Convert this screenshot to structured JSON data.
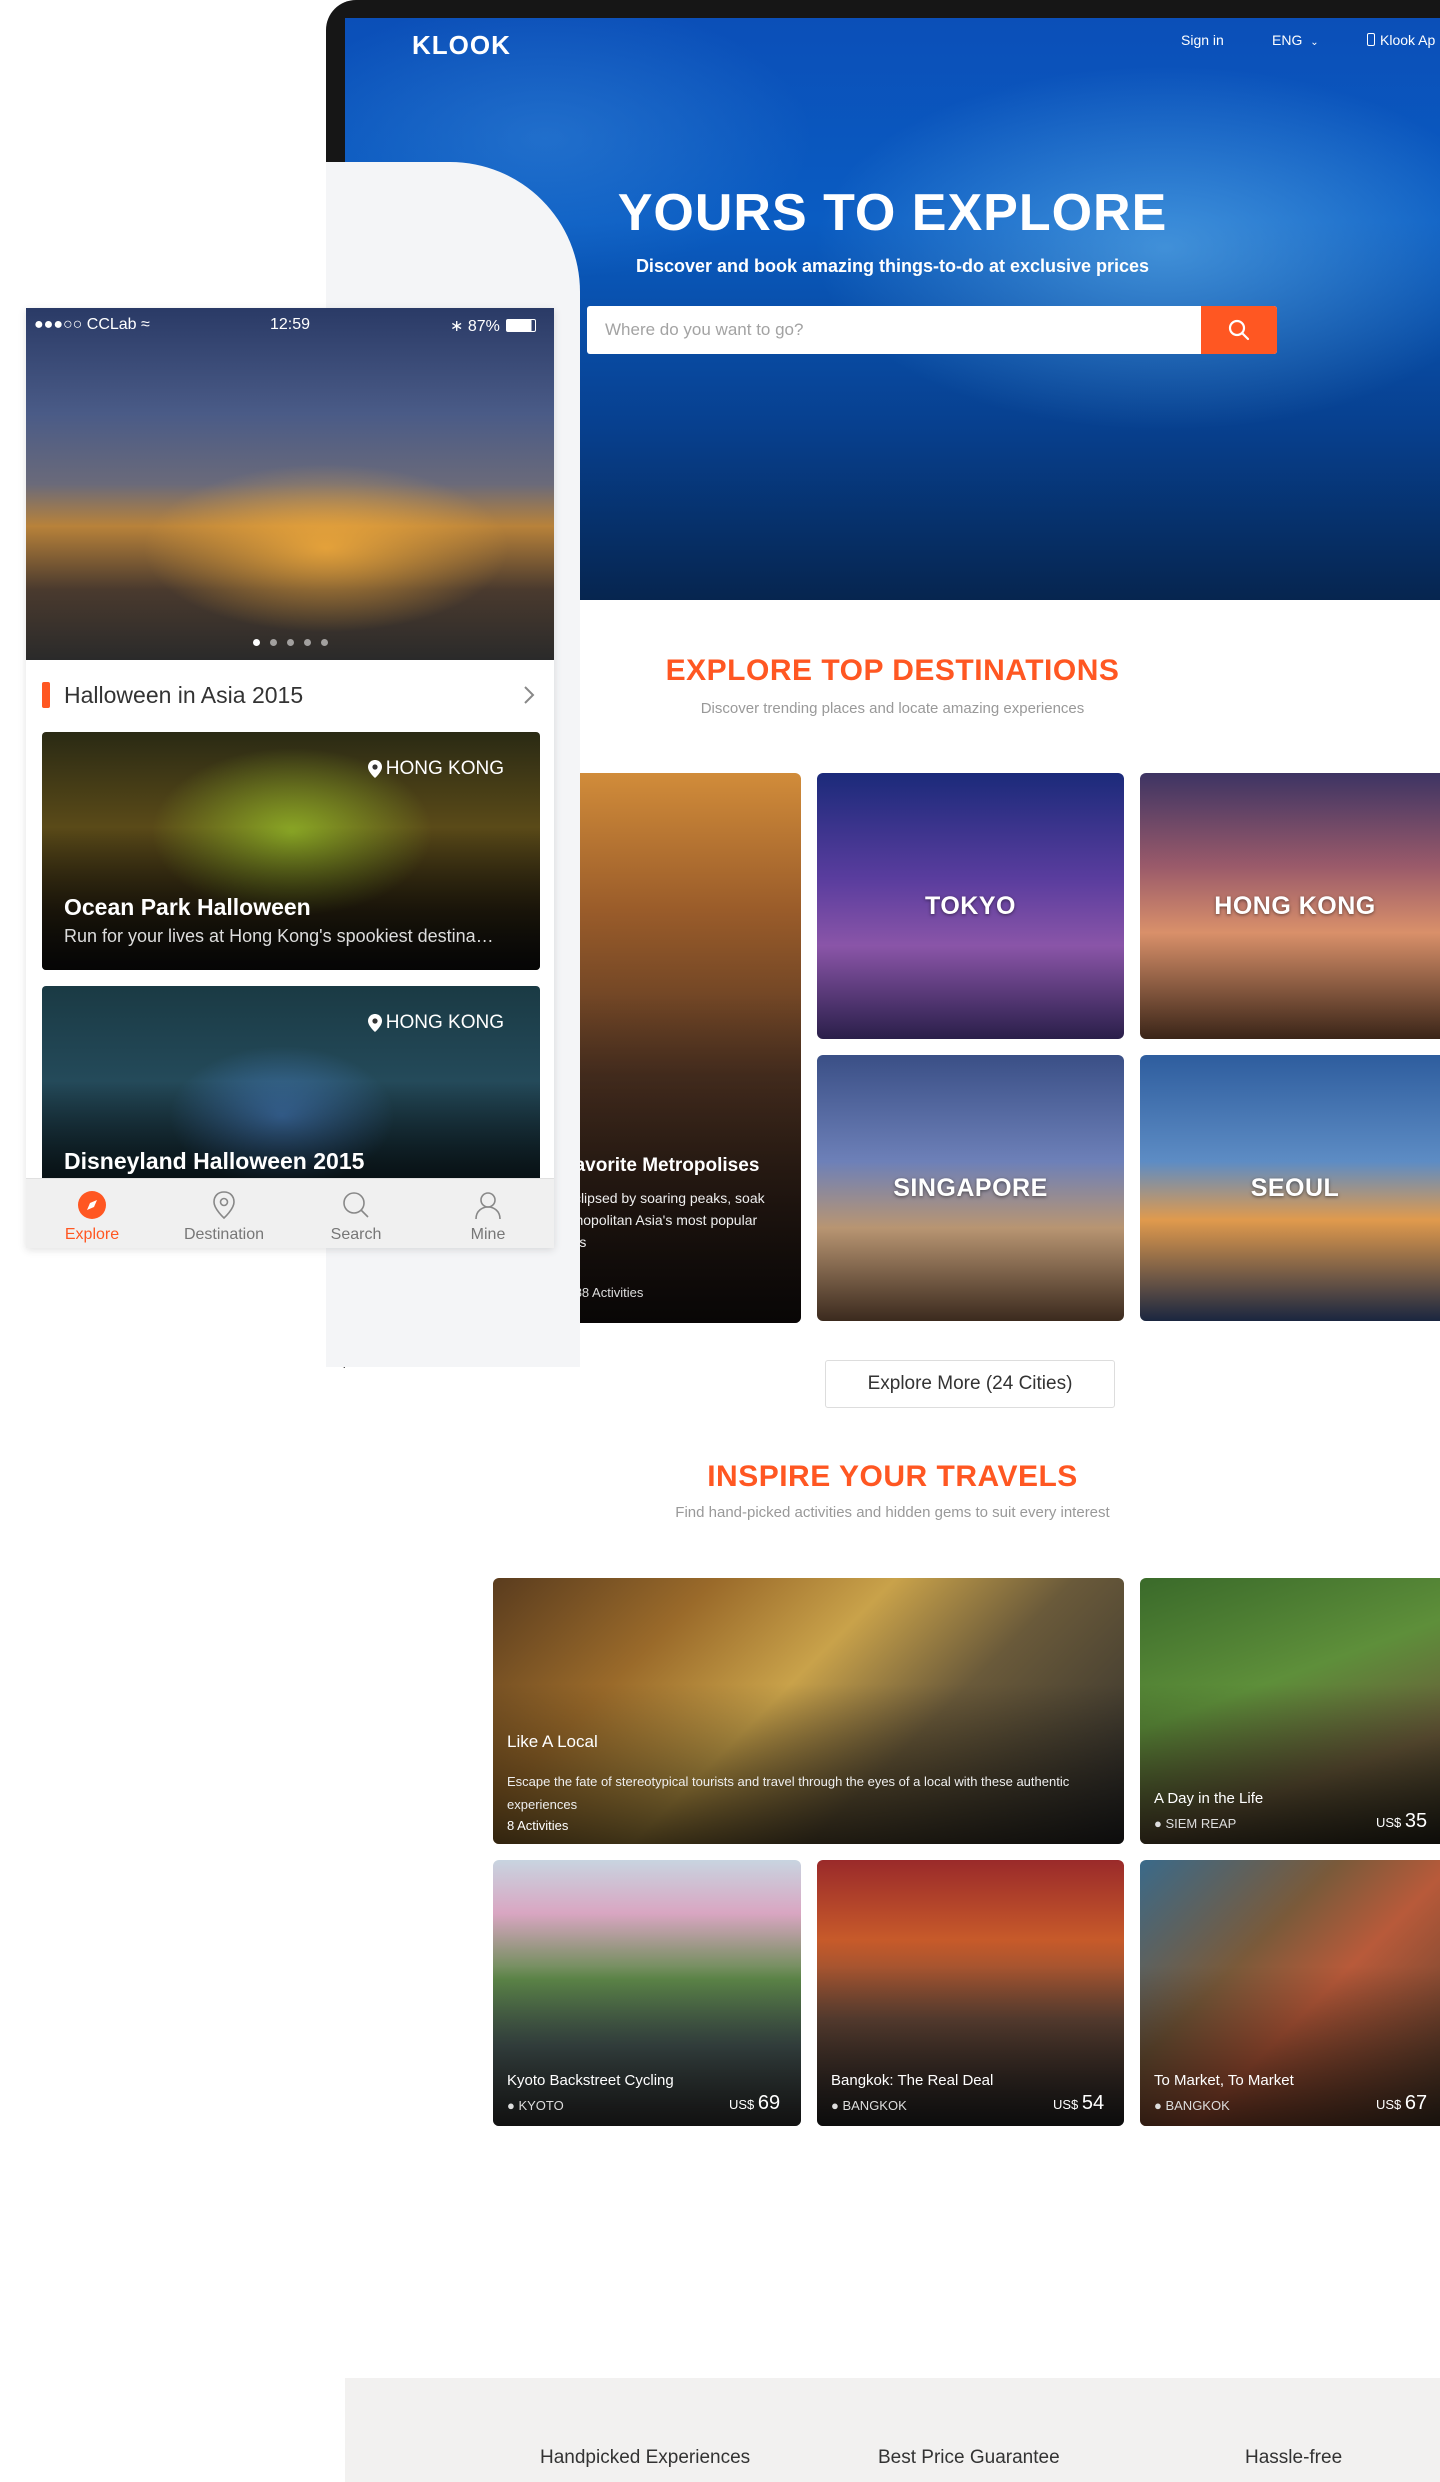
{
  "desktop": {
    "logo": "KLOOK",
    "nav": {
      "sign_in": "Sign in",
      "language": "ENG",
      "app": "Klook Ap"
    },
    "hero": {
      "title": "YOURS TO EXPLORE",
      "subtitle": "Discover and book amazing things-to-do at exclusive prices",
      "search_placeholder": "Where do you want to go?"
    },
    "destinations": {
      "title": "EXPLORE TOP DESTINATIONS",
      "subtitle": "Discover trending places and locate amazing experiences",
      "feature": {
        "title": "Favorite Metropolises",
        "description": "buildings eclipsed by soaring peaks, soak up the cosmopolitan Asia's most popular mother cities",
        "footer": "5 Places | 388 Activities"
      },
      "cities": [
        "TOKYO",
        "HONG KONG",
        "SINGAPORE",
        "SEOUL"
      ],
      "more_button": "Explore More (24 Cities)"
    },
    "inspire": {
      "title": "INSPIRE YOUR TRAVELS",
      "subtitle": "Find hand-picked activities and hidden gems to suit every interest",
      "feature": {
        "title": "Like A Local",
        "description": "Escape the fate of stereotypical tourists and travel through the eyes of a local with these authentic experiences",
        "count": "8 Activities"
      },
      "items": [
        {
          "title": "A Day in the Life",
          "location": "SIEM REAP",
          "currency": "US$",
          "price": "35"
        },
        {
          "title": "Kyoto Backstreet Cycling",
          "location": "KYOTO",
          "currency": "US$",
          "price": "69"
        },
        {
          "title": "Bangkok: The Real Deal",
          "location": "BANGKOK",
          "currency": "US$",
          "price": "54"
        },
        {
          "title": "To Market, To Market",
          "location": "BANGKOK",
          "currency": "US$",
          "price": "67"
        }
      ]
    },
    "features": [
      "Handpicked Experiences",
      "Best Price Guarantee",
      "Hassle-free"
    ]
  },
  "mobile": {
    "status": {
      "carrier": "CCLab",
      "time": "12:59",
      "battery": "87%"
    },
    "section_title": "Halloween in Asia 2015",
    "cards": [
      {
        "title": "Ocean Park Halloween",
        "subtitle": "Run for your lives at Hong Kong's spookiest destina…",
        "location": "HONG KONG"
      },
      {
        "title": "Disneyland Halloween 2015",
        "location": "HONG KONG"
      }
    ],
    "tabs": [
      "Explore",
      "Destination",
      "Search",
      "Mine"
    ]
  },
  "colors": {
    "accent": "#ff5722",
    "hero_blue": "#0a5cc2"
  }
}
